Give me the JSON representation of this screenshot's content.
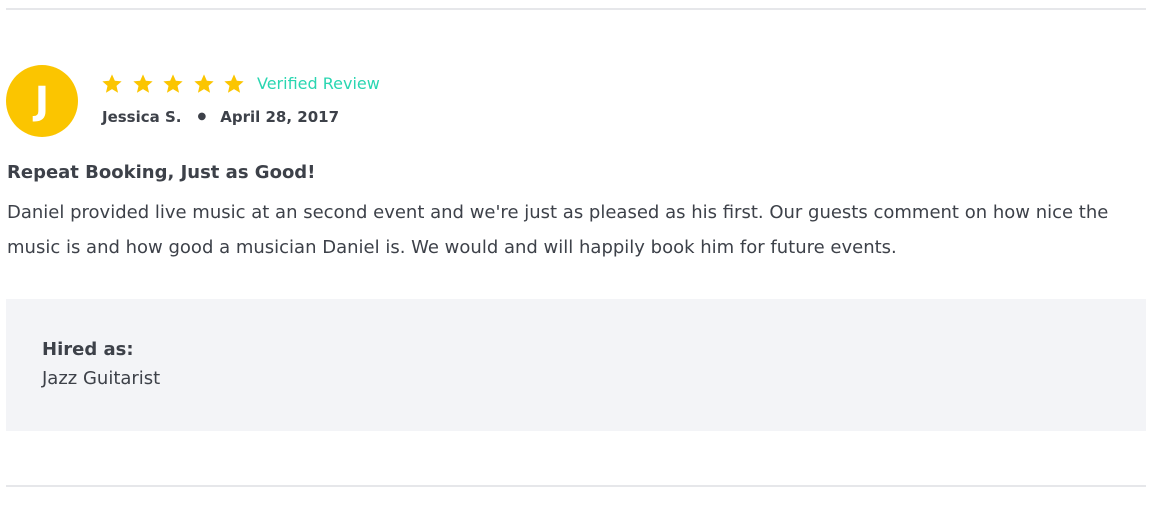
{
  "review": {
    "avatar_initial": "J",
    "rating": 5,
    "rating_max": 5,
    "verified_label": "Verified Review",
    "reviewer_name": "Jessica S.",
    "separator": "●",
    "date": "April 28, 2017",
    "title": "Repeat Booking, Just as Good!",
    "body": "Daniel provided live music at an second event and we're just as pleased as his first. Our guests comment on how nice the music is and how good a musician Daniel is. We would and will happily book him for future events.",
    "hired_as_label": "Hired as:",
    "hired_as_value": "Jazz Guitarist"
  },
  "colors": {
    "avatar": "#fbc500",
    "star": "#fbc500",
    "verified": "#2ad6b1",
    "text": "#3d4149",
    "hired_box_bg": "#f3f4f7",
    "divider": "#e6e7ea"
  },
  "icons": {
    "star": "star-icon"
  }
}
